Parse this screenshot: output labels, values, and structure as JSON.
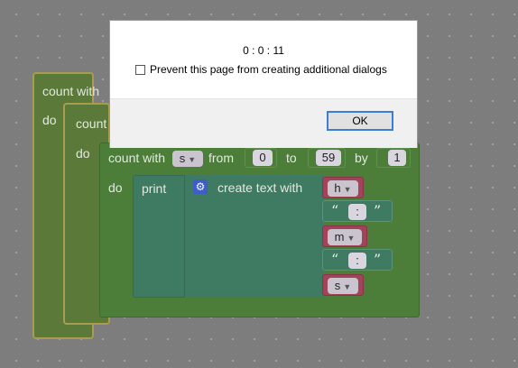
{
  "dialog": {
    "message": "0 : 0 : 11",
    "checkbox_label": "Prevent this page from creating additional dialogs",
    "ok_label": "OK"
  },
  "blocks": {
    "outer_loop": {
      "label": "count with",
      "do_label": "do"
    },
    "middle_loop": {
      "label": "count",
      "do_label": "do"
    },
    "inner_loop": {
      "label": "count with",
      "variable": "s",
      "from_label": "from",
      "from_value": "0",
      "to_label": "to",
      "to_value": "59",
      "by_label": "by",
      "by_value": "1",
      "do_label": "do"
    },
    "print": {
      "label": "print",
      "create_text_label": "create text with",
      "items": [
        {
          "type": "variable",
          "value": "h"
        },
        {
          "type": "text",
          "value": ":"
        },
        {
          "type": "variable",
          "value": "m"
        },
        {
          "type": "text",
          "value": ":"
        },
        {
          "type": "variable",
          "value": "s"
        }
      ],
      "quote_open": "“",
      "quote_close": "”"
    }
  },
  "colors": {
    "loop_block": "#5b7a3a",
    "text_block": "#3f7a62",
    "variable_block": "#a2435a",
    "highlight_border": "#a99c4f",
    "dialog_button_border": "#3b7fd4"
  },
  "icons": {
    "mutator": "gear-icon",
    "dropdown": "chevron-down-icon"
  }
}
